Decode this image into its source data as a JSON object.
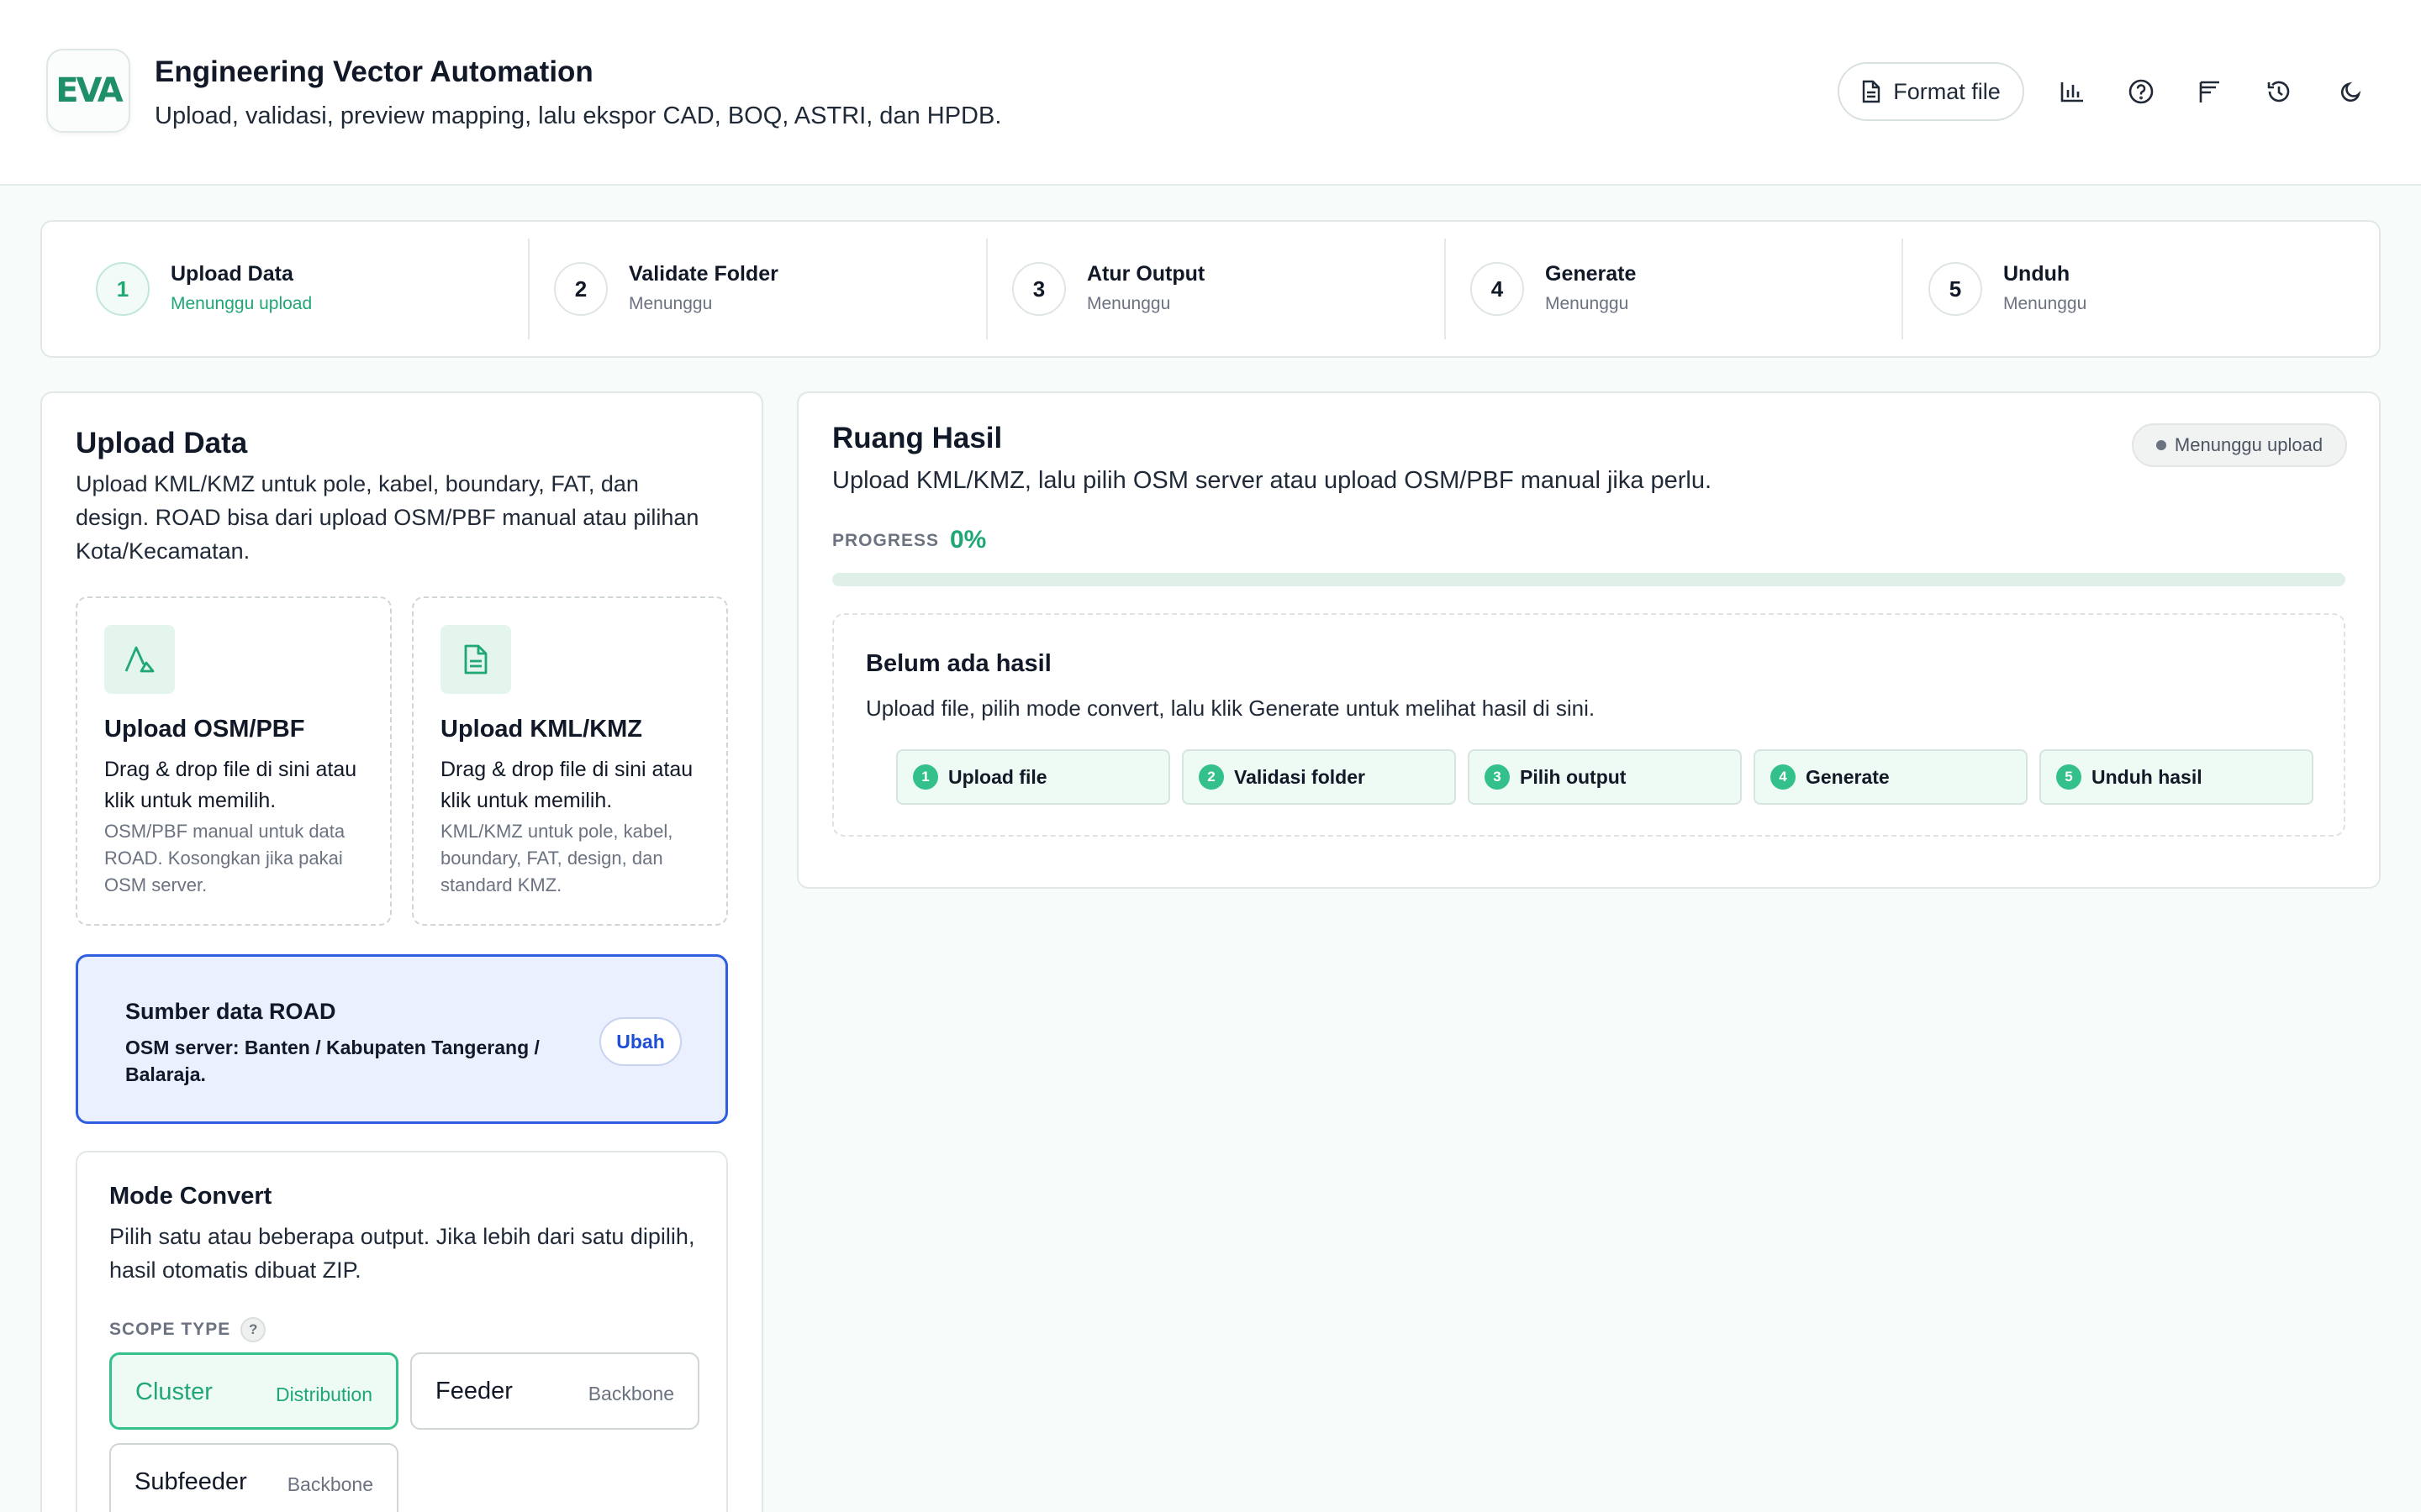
{
  "header": {
    "logo_text": "EVA",
    "title": "Engineering Vector Automation",
    "subtitle": "Upload, validasi, preview mapping, lalu ekspor CAD, BOQ, ASTRI, dan HPDB.",
    "format_button": "Format file",
    "icons": [
      "chart-icon",
      "help-icon",
      "list-icon",
      "history-icon",
      "moon-icon"
    ]
  },
  "stepper": [
    {
      "num": "1",
      "title": "Upload Data",
      "status": "Menunggu upload"
    },
    {
      "num": "2",
      "title": "Validate Folder",
      "status": "Menunggu"
    },
    {
      "num": "3",
      "title": "Atur Output",
      "status": "Menunggu"
    },
    {
      "num": "4",
      "title": "Generate",
      "status": "Menunggu"
    },
    {
      "num": "5",
      "title": "Unduh",
      "status": "Menunggu"
    }
  ],
  "upload": {
    "title": "Upload Data",
    "description": "Upload KML/KMZ untuk pole, kabel, boundary, FAT, dan design. ROAD bisa dari upload OSM/PBF manual atau pilihan Kota/Kecamatan.",
    "osm": {
      "title": "Upload OSM/PBF",
      "desc": "Drag & drop file di sini atau klik untuk memilih.",
      "note": "OSM/PBF manual untuk data ROAD. Kosongkan jika pakai OSM server."
    },
    "kml": {
      "title": "Upload KML/KMZ",
      "desc": "Drag & drop file di sini atau klik untuk memilih.",
      "note": "KML/KMZ untuk pole, kabel, boundary, FAT, design, dan standard KMZ."
    },
    "road": {
      "title": "Sumber data ROAD",
      "desc": "OSM server: Banten / Kabupaten Tangerang / Balaraja.",
      "button": "Ubah"
    }
  },
  "mode": {
    "title": "Mode Convert",
    "desc": "Pilih satu atau beberapa output. Jika lebih dari satu dipilih, hasil otomatis dibuat ZIP.",
    "scope_label": "SCOPE TYPE",
    "help": "?",
    "options": [
      {
        "name": "Cluster",
        "sub": "Distribution",
        "selected": true
      },
      {
        "name": "Feeder",
        "sub": "Backbone",
        "selected": false
      },
      {
        "name": "Subfeeder",
        "sub": "Backbone",
        "selected": false
      }
    ]
  },
  "result": {
    "title": "Ruang Hasil",
    "desc": "Upload KML/KMZ, lalu pilih OSM server atau upload OSM/PBF manual jika perlu.",
    "status": "Menunggu upload",
    "progress_label": "PROGRESS",
    "progress_text": "0%",
    "progress_value": 0,
    "empty_title": "Belum ada hasil",
    "empty_desc": "Upload file, pilih mode convert, lalu klik Generate untuk melihat hasil di sini.",
    "chips": [
      {
        "num": "1",
        "label": "Upload file"
      },
      {
        "num": "2",
        "label": "Validasi folder"
      },
      {
        "num": "3",
        "label": "Pilih output"
      },
      {
        "num": "4",
        "label": "Generate"
      },
      {
        "num": "5",
        "label": "Unduh hasil"
      }
    ]
  },
  "colors": {
    "accent": "#1fa774",
    "road_border": "#2f5fe0",
    "road_bg": "#eaf0fd"
  }
}
